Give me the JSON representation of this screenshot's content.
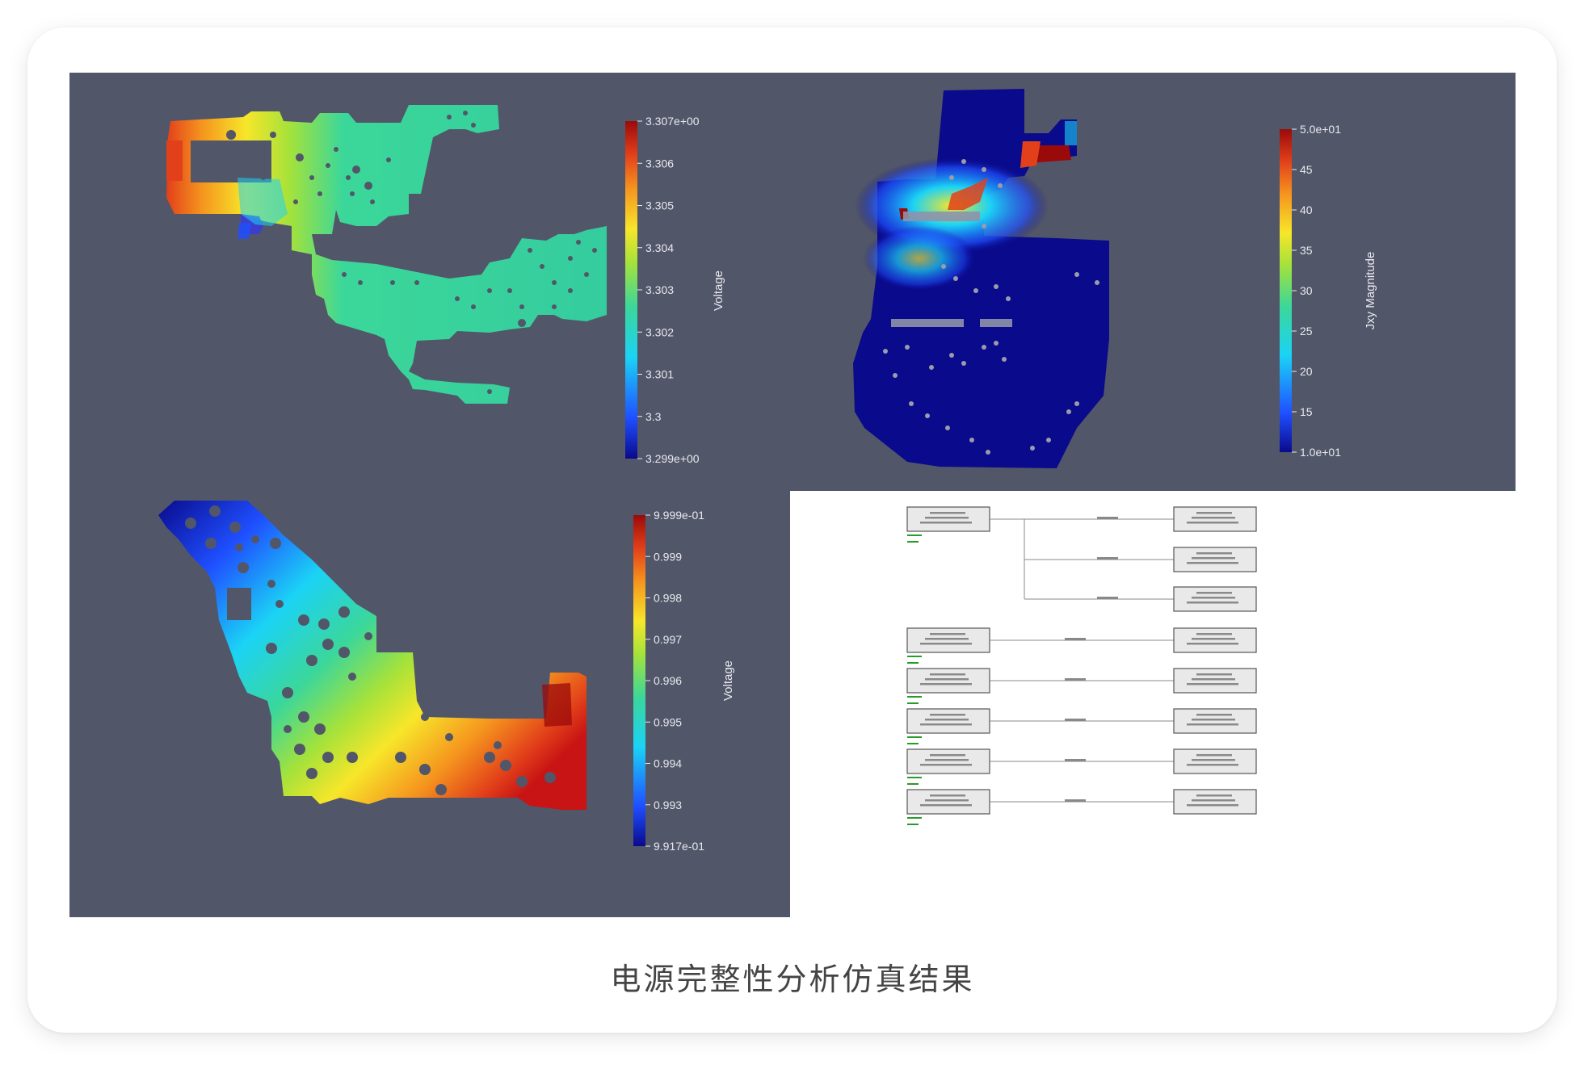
{
  "caption": "电源完整性分析仿真结果",
  "plots": [
    {
      "id": "top-left",
      "colorbar_title": "Voltage",
      "ticks": [
        "3.307e+00",
        "3.306",
        "3.305",
        "3.304",
        "3.303",
        "3.302",
        "3.301",
        "3.3",
        "3.299e+00"
      ],
      "colormap": "rainbow-blue-red"
    },
    {
      "id": "top-right",
      "colorbar_title": "Jxy Magnitude",
      "ticks": [
        "5.0e+01",
        "45",
        "40",
        "35",
        "30",
        "25",
        "20",
        "15",
        "1.0e+01"
      ],
      "colormap": "rainbow-blue-red"
    },
    {
      "id": "bottom-left",
      "colorbar_title": "Voltage",
      "ticks": [
        "9.999e-01",
        "0.999",
        "0.998",
        "0.997",
        "0.996",
        "0.995",
        "0.994",
        "0.993",
        "9.917e-01"
      ],
      "colormap": "rainbow-blue-red"
    }
  ],
  "colors": {
    "background": "#525669",
    "cmap": [
      "#0a0a8c",
      "#1f4fff",
      "#1bd3f5",
      "#3bd79a",
      "#a5e23a",
      "#f7e62a",
      "#f5941e",
      "#e2401a",
      "#9b0a0a"
    ]
  }
}
